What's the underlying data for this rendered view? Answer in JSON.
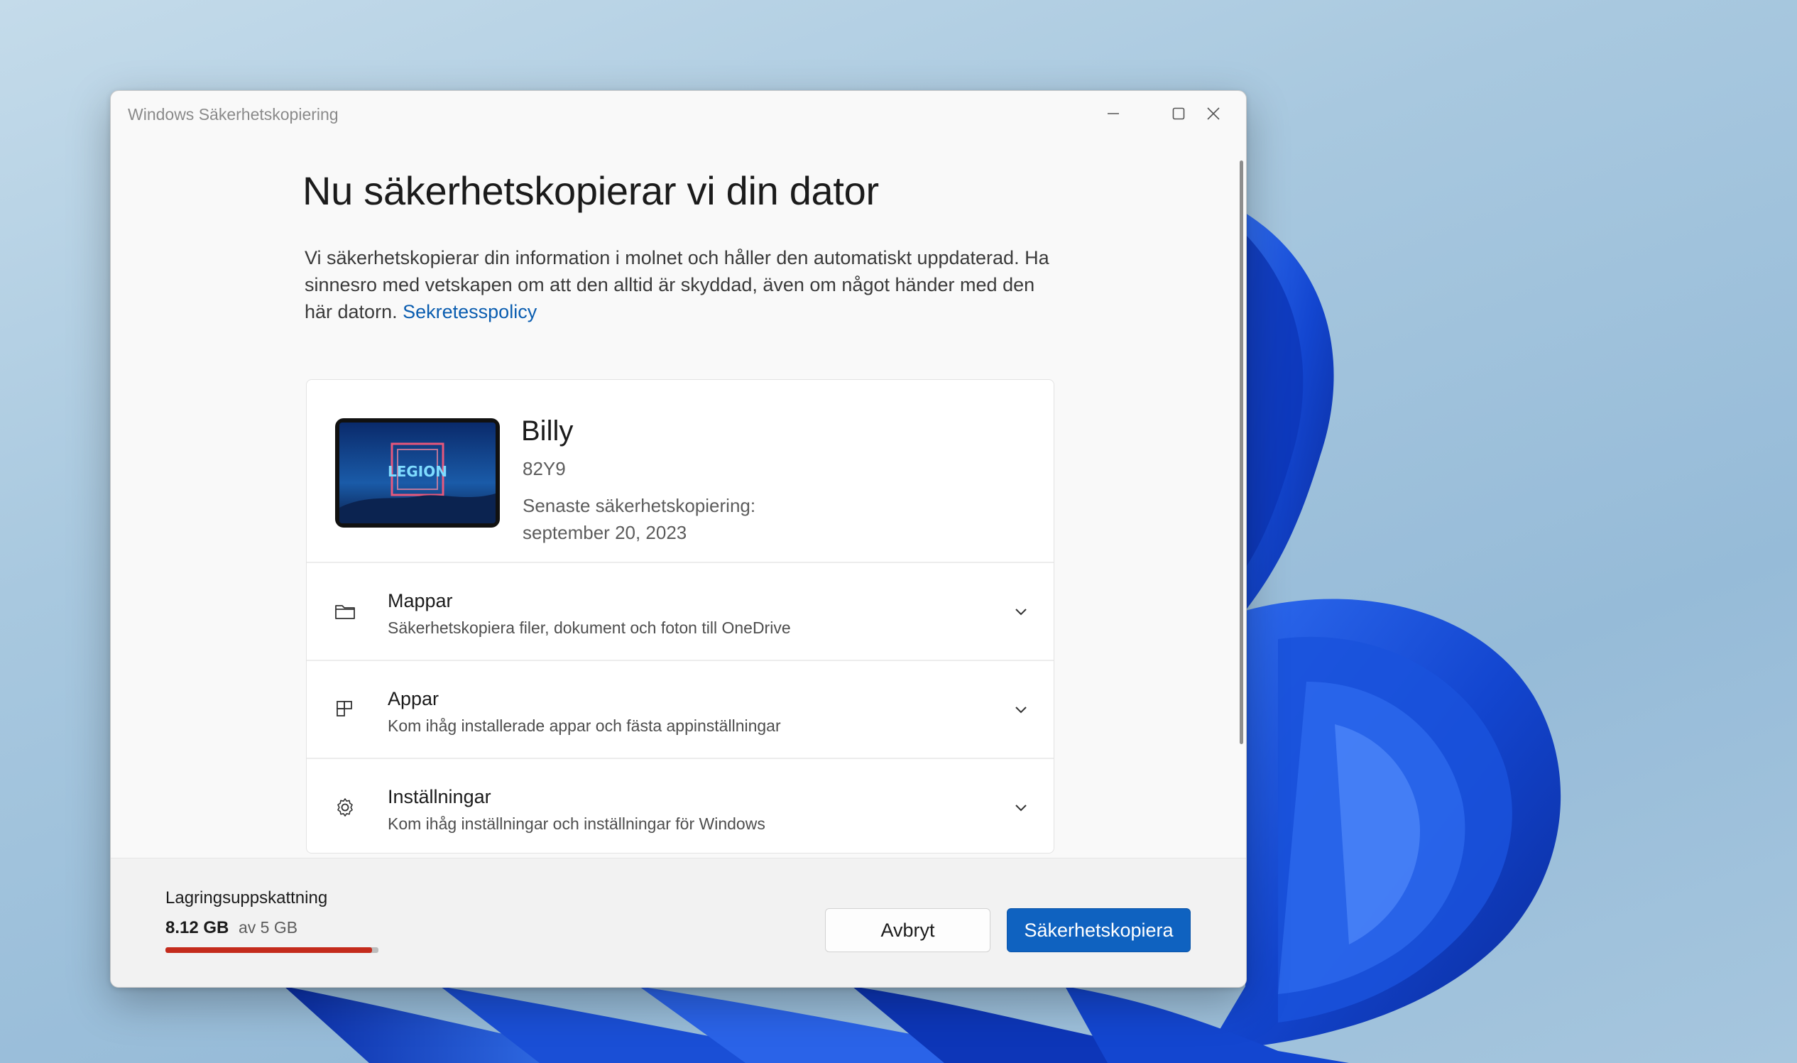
{
  "window": {
    "title": "Windows Säkerhetskopiering",
    "minimize_icon": "minimize-icon",
    "maximize_icon": "maximize-icon",
    "close_icon": "close-icon"
  },
  "main": {
    "heading": "Nu säkerhetskopierar vi din dator",
    "description": "Vi säkerhetskopierar din information i molnet och håller den automatiskt uppdaterad. Ha sinnesro med vetskapen om att den alltid är skyddad, även om något händer med den här datorn.",
    "privacy_link": "Sekretesspolicy"
  },
  "device": {
    "thumbnail_text": "LEGION",
    "name": "Billy",
    "model": "82Y9",
    "last_backup_label": "Senaste säkerhetskopiering:",
    "last_backup_date": "september 20, 2023"
  },
  "sections": [
    {
      "icon": "folder-icon",
      "title": "Mappar",
      "subtitle": "Säkerhetskopiera filer, dokument och foton till OneDrive"
    },
    {
      "icon": "apps-icon",
      "title": "Appar",
      "subtitle": "Kom ihåg installerade appar och fästa appinställningar"
    },
    {
      "icon": "gear-icon",
      "title": "Inställningar",
      "subtitle": "Kom ihåg inställningar och inställningar för Windows"
    }
  ],
  "footer": {
    "storage_label": "Lagringsuppskattning",
    "storage_used": "8.12 GB",
    "storage_total": "av 5 GB",
    "storage_fill_percent": 97,
    "storage_bar_color": "#c42b1c",
    "cancel_label": "Avbryt",
    "backup_label": "Säkerhetskopiera"
  },
  "colors": {
    "accent": "#0f62c0",
    "link": "#0a5db0",
    "wallpaper_bloom": "#1a4fd6"
  }
}
